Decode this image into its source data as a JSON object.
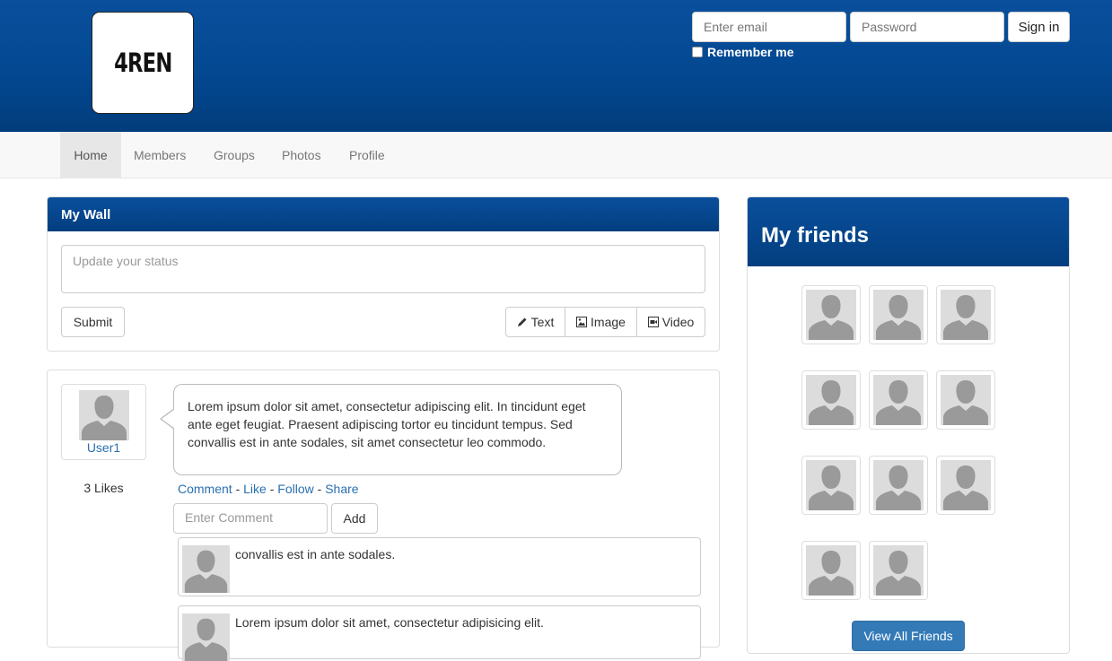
{
  "brand": {
    "logo_text": "4REN"
  },
  "login": {
    "email_placeholder": "Enter email",
    "password_placeholder": "Password",
    "signin_label": "Sign in",
    "remember_label": "Remember me"
  },
  "nav": {
    "items": [
      {
        "label": "Home",
        "active": true
      },
      {
        "label": "Members"
      },
      {
        "label": "Groups"
      },
      {
        "label": "Photos"
      },
      {
        "label": "Profile"
      }
    ]
  },
  "wall": {
    "title": "My Wall",
    "status_placeholder": "Update your status",
    "submit_label": "Submit",
    "media_buttons": [
      {
        "label": "Text",
        "icon": "pencil-icon"
      },
      {
        "label": "Image",
        "icon": "image-icon"
      },
      {
        "label": "Video",
        "icon": "video-icon"
      }
    ]
  },
  "post": {
    "author": "User1",
    "likes": "3 Likes",
    "body": "Lorem ipsum dolor sit amet, consectetur adipiscing elit. In tincidunt eget ante eget feugiat. Praesent adipiscing tortor eu tincidunt tempus. Sed convallis est in ante sodales, sit amet consectetur leo commodo.",
    "actions": [
      "Comment",
      "Like",
      "Follow",
      "Share"
    ],
    "action_separator": "-",
    "comment_placeholder": "Enter Comment",
    "add_label": "Add",
    "comments": [
      {
        "text": "convallis est in ante sodales."
      },
      {
        "text": "Lorem ipsum dolor sit amet, consectetur adipisicing elit."
      }
    ]
  },
  "friends": {
    "title": "My friends",
    "count": 11,
    "view_all_label": "View All Friends"
  },
  "colors": {
    "header_blue": "#034891",
    "link_blue": "#2a6fb0",
    "primary_button": "#337ab7",
    "avatar_grey": "#9a9a9a"
  }
}
